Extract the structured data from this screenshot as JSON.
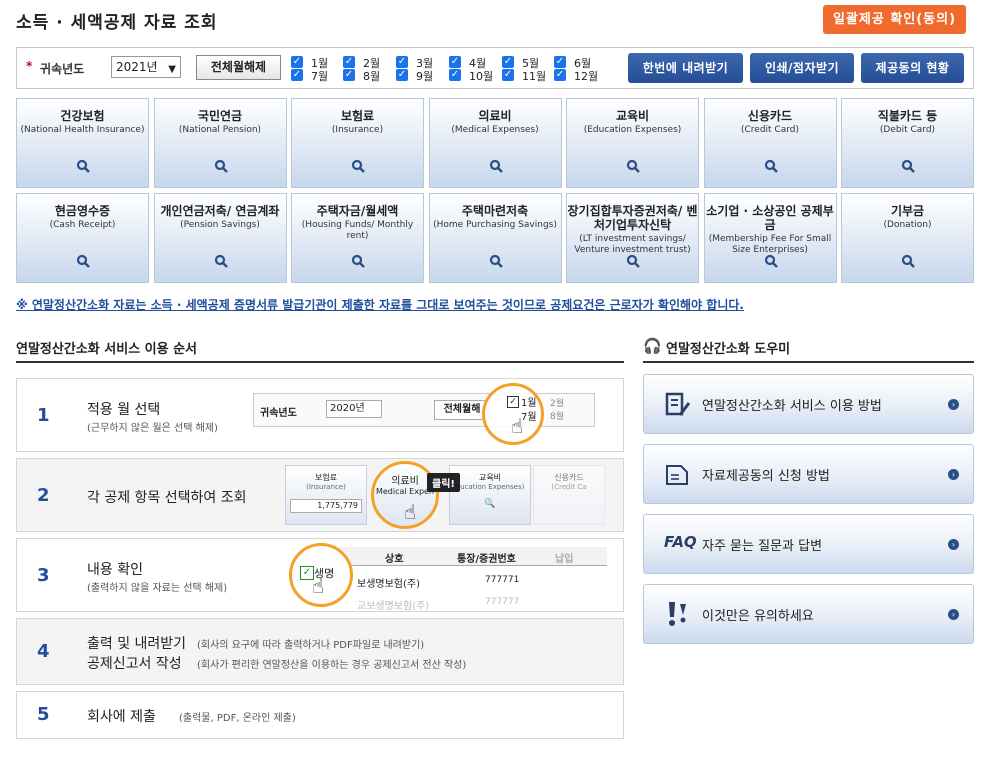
{
  "header": {
    "title": "소득 · 세액공제 자료 조회",
    "consent_button": "일괄제공 확인(동의)"
  },
  "filter": {
    "year_label": "귀속년도",
    "year_value": "2021년",
    "deselect_all": "전체월해제",
    "months": [
      "1월",
      "2월",
      "3월",
      "4월",
      "5월",
      "6월",
      "7월",
      "8월",
      "9월",
      "10월",
      "11월",
      "12월"
    ],
    "check_glyph": "✓",
    "buttons": [
      "한번에 내려받기",
      "인쇄/점자받기",
      "제공동의 현황"
    ]
  },
  "categories": [
    {
      "ko": "건강보험",
      "en": "(National Health Insurance)"
    },
    {
      "ko": "국민연금",
      "en": "(National Pension)"
    },
    {
      "ko": "보험료",
      "en": "(Insurance)"
    },
    {
      "ko": "의료비",
      "en": "(Medical Expenses)"
    },
    {
      "ko": "교육비",
      "en": "(Education Expenses)"
    },
    {
      "ko": "신용카드",
      "en": "(Credit Card)"
    },
    {
      "ko": "직불카드 등",
      "en": "(Debit Card)"
    },
    {
      "ko": "현금영수증",
      "en": "(Cash Receipt)"
    },
    {
      "ko": "개인연금저축/ 연금계좌",
      "en": "(Pension Savings)"
    },
    {
      "ko": "주택자금/월세액",
      "en": "(Housing Funds/ Monthly rent)"
    },
    {
      "ko": "주택마련저축",
      "en": "(Home Purchasing Savings)"
    },
    {
      "ko": "장기집합투자증권저축/ 벤처기업투자신탁",
      "en": "(LT investment savings/ Venture investment trust)"
    },
    {
      "ko": "소기업 · 소상공인 공제부금",
      "en": "(Membership Fee For Small Size Enterprises)"
    },
    {
      "ko": "기부금",
      "en": "(Donation)"
    }
  ],
  "notice": "※ 연말정산간소화 자료는 소득 · 세액공제 증명서류 발급기관이 제출한 자료를 그대로 보여주는 것이므로 공제요건은 근로자가 확인해야 합니다.",
  "service_order": {
    "title": "연말정산간소화 서비스 이용 순서",
    "steps": [
      {
        "num": "1",
        "title": "적용 월 선택",
        "sub": "(근무하지 않은 월은 선택 해제)"
      },
      {
        "num": "2",
        "title": "각 공제 항목 선택하여 조회",
        "sub": ""
      },
      {
        "num": "3",
        "title": "내용 확인",
        "sub": "(출력하지 않을 자료는 선택 해제)"
      },
      {
        "num": "4",
        "title": "출력 및 내려받기",
        "title2": "공제신고서 작성",
        "sub": "(회사의 요구에 따라 출력하거나 PDF파일로 내려받기)",
        "sub2": "(회사가 편리한 연말정산을 이용하는 경우 공제신고서 전산 작성)"
      },
      {
        "num": "5",
        "title": "회사에 제출",
        "sub": "(출력물, PDF, 온라인 제출)"
      }
    ],
    "ill1": {
      "year_label": "귀속년도",
      "year_value": "2020년",
      "btn": "전체월해",
      "m1": "1월",
      "m7": "7월",
      "m2": "2월",
      "m8": "8월"
    },
    "ill2": {
      "c1_ko": "보험료",
      "c1_en": "(Insurance)",
      "c1_val": "1,775,779",
      "c2_ko": "의료비",
      "c2_en": "Medical Expen",
      "c3_ko": "교육비",
      "c3_en": "ducation Expenses)",
      "c4_ko": "신용카드",
      "c4_en": "(Credit Ca",
      "click": "클릭!"
    },
    "ill3": {
      "col1": "상호",
      "col2": "통장/증권번호",
      "col3": "납입",
      "row1_a": "생명",
      "row1_b": "보생명보험(주)",
      "row1_c": "777771",
      "row2_b": "교보생명보험(주)",
      "row2_c": "777777"
    }
  },
  "help": {
    "title": "연말정산간소화 도우미",
    "items": [
      {
        "label": "연말정산간소화 서비스 이용 방법",
        "icon": "document-edit-icon"
      },
      {
        "label": "자료제공동의 신청 방법",
        "icon": "document-icon"
      },
      {
        "prefix": "FAQ",
        "label": "자주 묻는 질문과 답변",
        "icon": "faq-icon"
      },
      {
        "label": "이것만은 유의하세요",
        "icon": "exclamation-icon"
      }
    ]
  }
}
